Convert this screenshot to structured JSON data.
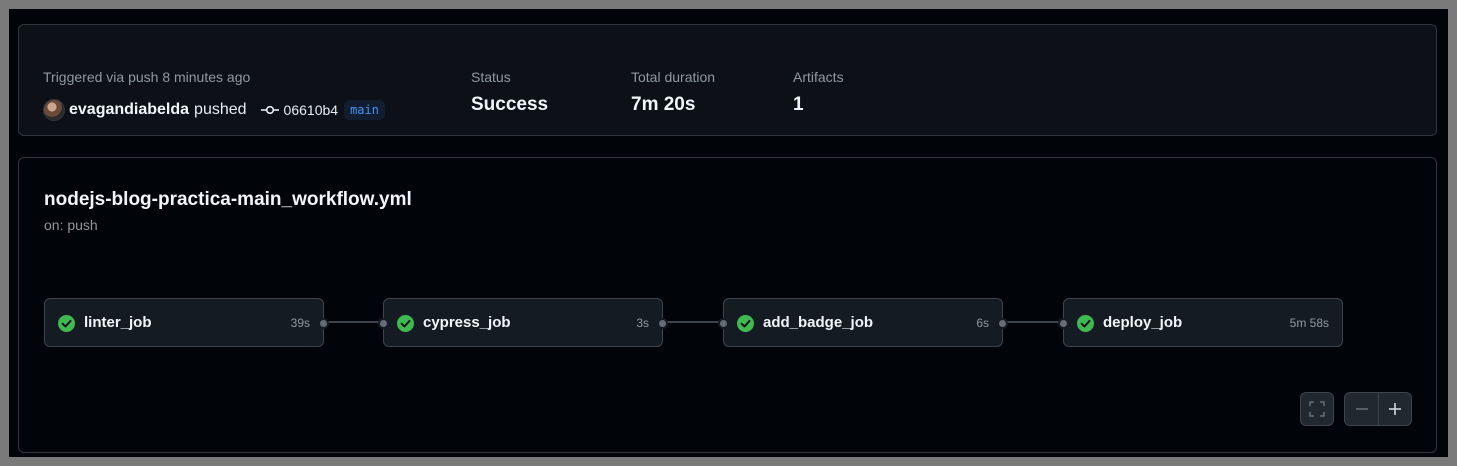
{
  "summary": {
    "trigger_label": "Triggered via push 8 minutes ago",
    "actor": "evagandiabelda",
    "action": "pushed",
    "commit_sha": "06610b4",
    "branch": "main",
    "status_label": "Status",
    "status_value": "Success",
    "duration_label": "Total duration",
    "duration_value": "7m 20s",
    "artifacts_label": "Artifacts",
    "artifacts_value": "1"
  },
  "workflow": {
    "file": "nodejs-blog-practica-main_workflow.yml",
    "trigger": "on: push"
  },
  "jobs": [
    {
      "name": "linter_job",
      "duration": "39s",
      "status": "success"
    },
    {
      "name": "cypress_job",
      "duration": "3s",
      "status": "success"
    },
    {
      "name": "add_badge_job",
      "duration": "6s",
      "status": "success"
    },
    {
      "name": "deploy_job",
      "duration": "5m 58s",
      "status": "success"
    }
  ],
  "controls": {
    "fullscreen_icon": "fullscreen-icon",
    "zoom_out_icon": "minus-icon",
    "zoom_in_icon": "plus-icon"
  },
  "colors": {
    "success": "#3fb950",
    "branch_text": "#4493f8"
  }
}
